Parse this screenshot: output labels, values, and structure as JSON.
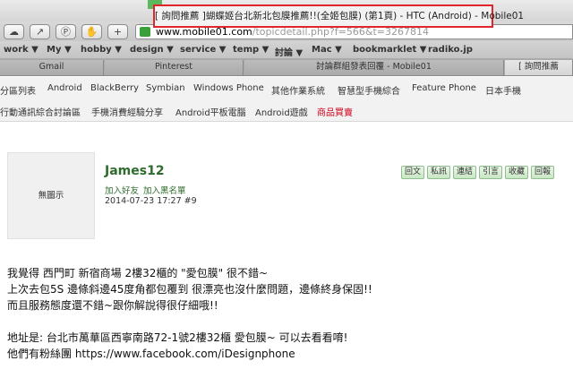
{
  "window": {
    "title": "[ 詢問推薦 ]蝴蝶姬台北新北包膜推薦!!(全姬包膜) (第1頁) - HTC (Android) - Mobile01"
  },
  "toolbar": {
    "url_host": "www.mobile01.com",
    "url_path": "/topicdetail.php?f=566&t=3267814"
  },
  "bookmarks": [
    "work ▼",
    "My ▼",
    "hobby ▼",
    "design ▼",
    "service ▼",
    "temp ▼",
    "討論 ▼",
    "Mac ▼",
    "bookmarklet ▼",
    "radiko.jp"
  ],
  "tabs": [
    "Gmail",
    "Pinterest",
    "討論群組發表回覆 - Mobile01",
    "[ 詢問推薦"
  ],
  "nav": {
    "row1": [
      "分區列表",
      "Android",
      "BlackBerry",
      "Symbian",
      "Windows Phone",
      "其他作業系統",
      "智慧型手機綜合",
      "Feature Phone",
      "日本手機"
    ],
    "row2": [
      "行動通訊綜合討論區",
      "手機消費經驗分享",
      "Android平板電腦",
      "Android遊戲",
      "商品買賣"
    ]
  },
  "post": {
    "avatar_text": "無圖示",
    "username": "James12",
    "add_friend": "加入好友",
    "blacklist": "加入黑名單",
    "datetime": "2014-07-23 17:27",
    "floor": "#9",
    "actions": [
      "回文",
      "私訊",
      "連結",
      "引言",
      "收藏",
      "回報"
    ],
    "lines": [
      "我覺得 西門町 新宿商場 2樓32櫃的 \"愛包膜\" 很不錯~",
      "上次去包5S 邊條斜邊45度角都包覆到 很漂亮也沒什麼問題，邊條終身保固!!",
      "而且服務態度還不錯~跟你解說得很仔細哦!!",
      "",
      "地址是: 台北市萬華區西寧南路72-1號2樓32櫃 愛包膜~ 可以去看看唷!",
      "他們有粉絲團 https://www.facebook.com/iDesignphone"
    ]
  },
  "colors": {
    "highlight_border": "#e0262b",
    "username": "#2d6c2d",
    "sale_link": "#d0021b"
  }
}
